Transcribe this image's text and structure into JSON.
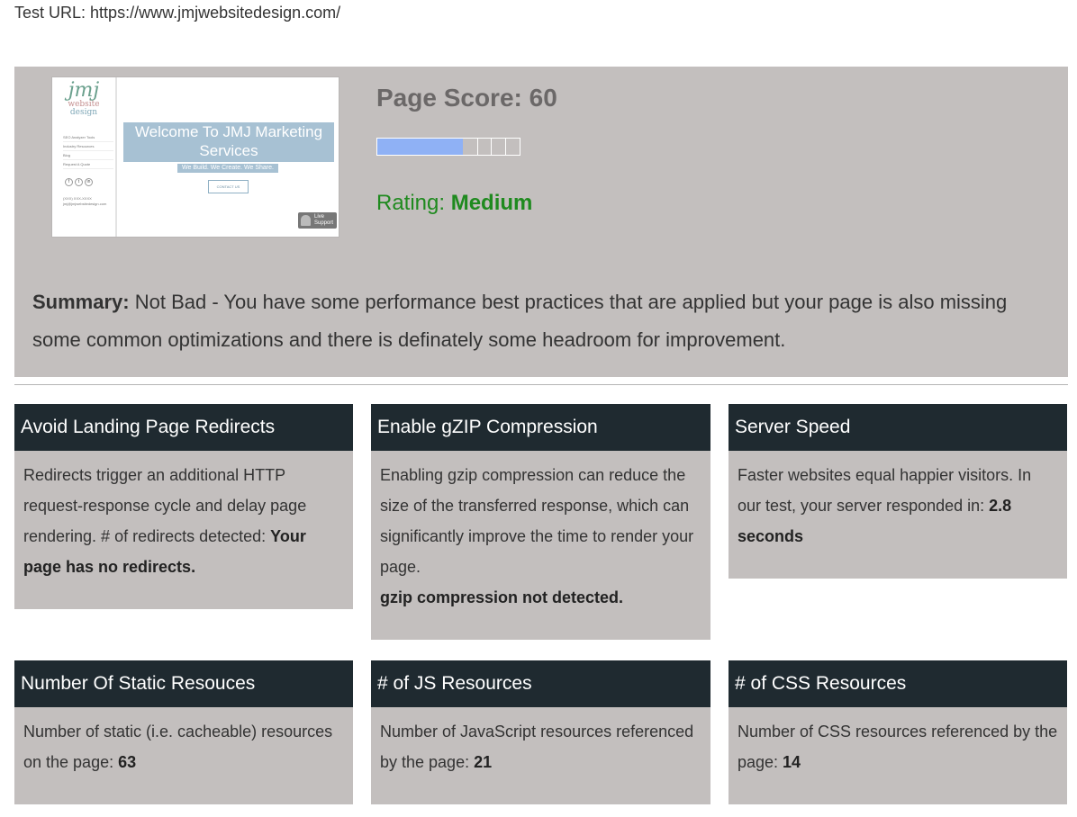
{
  "test_url": {
    "label": "Test URL:",
    "url": "https://www.jmjwebsitedesign.com/"
  },
  "thumbnail": {
    "logo_main": "jmj",
    "logo_line2": "website",
    "logo_line3": "design",
    "nav_items": [
      "SEO Analyzer Tools",
      "Industry Resources",
      "Blog",
      "Request A Quote"
    ],
    "contact_lines": [
      "(XXX) XXX-XXXX",
      "jmj@jmjwebsitedesign.com"
    ],
    "hero": "Welcome To JMJ Marketing Services",
    "tagline": "We Build. We Create. We Share.",
    "button": "CONTACT US",
    "live_support": "Live Support"
  },
  "score": {
    "label": "Page Score:",
    "value": 60,
    "rating_label": "Rating:",
    "rating": "Medium",
    "bar_fraction": 0.6
  },
  "summary": {
    "label": "Summary:",
    "text": "Not Bad - You have some performance best practices that are applied but your page is also missing some common optimizations and there is definately some headroom for improvement."
  },
  "cards": [
    {
      "title": "Avoid Landing Page Redirects",
      "text": "Redirects trigger an additional HTTP request-response cycle and delay page rendering. # of redirects detected: ",
      "bold": "Your page has no redirects.",
      "extra": ""
    },
    {
      "title": "Enable gZIP Compression",
      "text": "Enabling gzip compression can reduce the size of the transferred response, which can significantly improve the time to render your page.",
      "bold": "",
      "extra": "gzip compression not detected."
    },
    {
      "title": "Server Speed",
      "text": "Faster websites equal happier visitors. In our test, your server responded in: ",
      "bold": "2.8 seconds",
      "extra": ""
    },
    {
      "title": "Number Of Static Resouces",
      "text": "Number of static (i.e. cacheable) resources on the page: ",
      "bold": "63",
      "extra": ""
    },
    {
      "title": "# of JS Resources",
      "text": "Number of JavaScript resources referenced by the page: ",
      "bold": "21",
      "extra": ""
    },
    {
      "title": "# of CSS Resources",
      "text": "Number of CSS resources referenced by the page: ",
      "bold": "14",
      "extra": ""
    }
  ],
  "colors": {
    "panel": "#c3bfbe",
    "card_header": "#1f2a30",
    "rating": "#1f8a1f",
    "bar_fill": "#8fb1f5"
  }
}
